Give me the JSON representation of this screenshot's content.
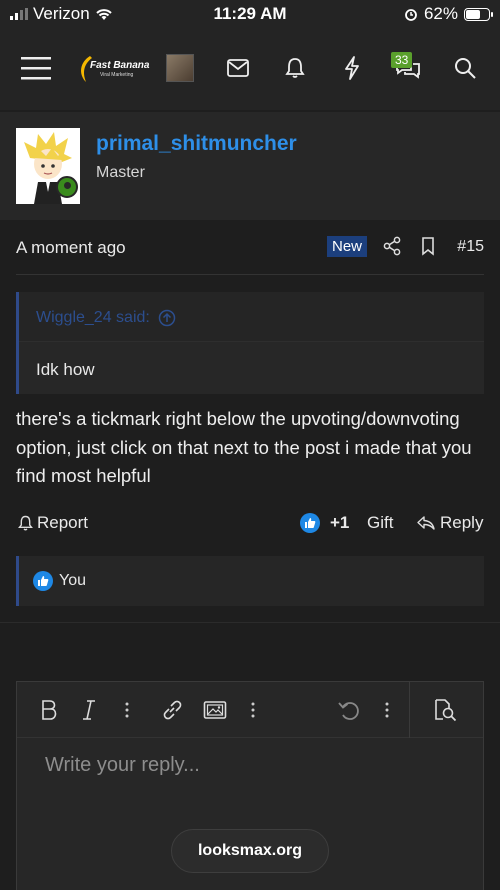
{
  "status_bar": {
    "carrier": "Verizon",
    "time": "11:29 AM",
    "battery": "62%"
  },
  "nav": {
    "logo_text": "Fast Banana",
    "logo_sub": "Viral Marketing",
    "chat_badge": "33"
  },
  "post": {
    "username": "primal_shitmuncher",
    "user_title": "Master",
    "time": "A moment ago",
    "new_tag": "New",
    "post_number": "#15",
    "quote": {
      "author": "Wiggle_24 said:",
      "text": "Idk how"
    },
    "body": "there's a tickmark right below the upvoting/downvoting option, just click on that next to the post i made that you find most helpful",
    "actions": {
      "report": "Report",
      "score": "+1",
      "gift": "Gift",
      "reply": "Reply"
    },
    "likes": "You"
  },
  "editor": {
    "placeholder": "Write your reply..."
  },
  "domain": "looksmax.org",
  "colors": {
    "accent": "#2e8fe8",
    "new_tag": "#1c3f7d",
    "online": "#3a8b1d",
    "badge": "#5aa02c"
  }
}
